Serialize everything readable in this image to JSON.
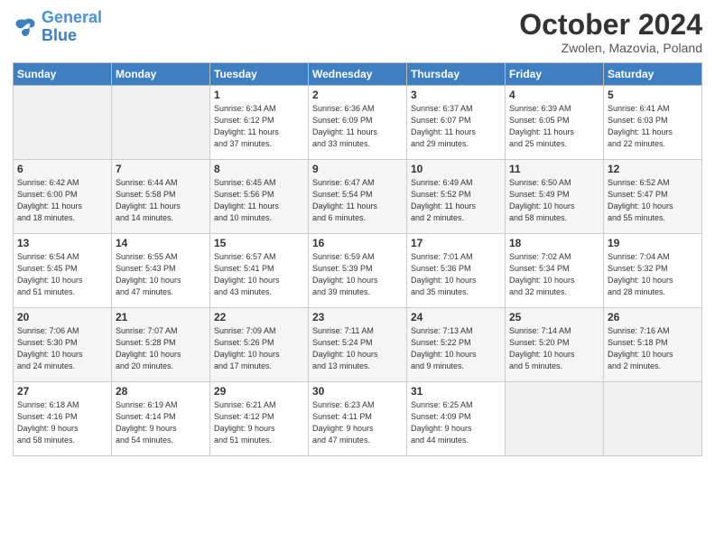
{
  "logo": {
    "line1": "General",
    "line2": "Blue"
  },
  "title": "October 2024",
  "subtitle": "Zwolen, Mazovia, Poland",
  "days_header": [
    "Sunday",
    "Monday",
    "Tuesday",
    "Wednesday",
    "Thursday",
    "Friday",
    "Saturday"
  ],
  "weeks": [
    [
      {
        "day": "",
        "info": ""
      },
      {
        "day": "",
        "info": ""
      },
      {
        "day": "1",
        "info": "Sunrise: 6:34 AM\nSunset: 6:12 PM\nDaylight: 11 hours\nand 37 minutes."
      },
      {
        "day": "2",
        "info": "Sunrise: 6:36 AM\nSunset: 6:09 PM\nDaylight: 11 hours\nand 33 minutes."
      },
      {
        "day": "3",
        "info": "Sunrise: 6:37 AM\nSunset: 6:07 PM\nDaylight: 11 hours\nand 29 minutes."
      },
      {
        "day": "4",
        "info": "Sunrise: 6:39 AM\nSunset: 6:05 PM\nDaylight: 11 hours\nand 25 minutes."
      },
      {
        "day": "5",
        "info": "Sunrise: 6:41 AM\nSunset: 6:03 PM\nDaylight: 11 hours\nand 22 minutes."
      }
    ],
    [
      {
        "day": "6",
        "info": "Sunrise: 6:42 AM\nSunset: 6:00 PM\nDaylight: 11 hours\nand 18 minutes."
      },
      {
        "day": "7",
        "info": "Sunrise: 6:44 AM\nSunset: 5:58 PM\nDaylight: 11 hours\nand 14 minutes."
      },
      {
        "day": "8",
        "info": "Sunrise: 6:45 AM\nSunset: 5:56 PM\nDaylight: 11 hours\nand 10 minutes."
      },
      {
        "day": "9",
        "info": "Sunrise: 6:47 AM\nSunset: 5:54 PM\nDaylight: 11 hours\nand 6 minutes."
      },
      {
        "day": "10",
        "info": "Sunrise: 6:49 AM\nSunset: 5:52 PM\nDaylight: 11 hours\nand 2 minutes."
      },
      {
        "day": "11",
        "info": "Sunrise: 6:50 AM\nSunset: 5:49 PM\nDaylight: 10 hours\nand 58 minutes."
      },
      {
        "day": "12",
        "info": "Sunrise: 6:52 AM\nSunset: 5:47 PM\nDaylight: 10 hours\nand 55 minutes."
      }
    ],
    [
      {
        "day": "13",
        "info": "Sunrise: 6:54 AM\nSunset: 5:45 PM\nDaylight: 10 hours\nand 51 minutes."
      },
      {
        "day": "14",
        "info": "Sunrise: 6:55 AM\nSunset: 5:43 PM\nDaylight: 10 hours\nand 47 minutes."
      },
      {
        "day": "15",
        "info": "Sunrise: 6:57 AM\nSunset: 5:41 PM\nDaylight: 10 hours\nand 43 minutes."
      },
      {
        "day": "16",
        "info": "Sunrise: 6:59 AM\nSunset: 5:39 PM\nDaylight: 10 hours\nand 39 minutes."
      },
      {
        "day": "17",
        "info": "Sunrise: 7:01 AM\nSunset: 5:36 PM\nDaylight: 10 hours\nand 35 minutes."
      },
      {
        "day": "18",
        "info": "Sunrise: 7:02 AM\nSunset: 5:34 PM\nDaylight: 10 hours\nand 32 minutes."
      },
      {
        "day": "19",
        "info": "Sunrise: 7:04 AM\nSunset: 5:32 PM\nDaylight: 10 hours\nand 28 minutes."
      }
    ],
    [
      {
        "day": "20",
        "info": "Sunrise: 7:06 AM\nSunset: 5:30 PM\nDaylight: 10 hours\nand 24 minutes."
      },
      {
        "day": "21",
        "info": "Sunrise: 7:07 AM\nSunset: 5:28 PM\nDaylight: 10 hours\nand 20 minutes."
      },
      {
        "day": "22",
        "info": "Sunrise: 7:09 AM\nSunset: 5:26 PM\nDaylight: 10 hours\nand 17 minutes."
      },
      {
        "day": "23",
        "info": "Sunrise: 7:11 AM\nSunset: 5:24 PM\nDaylight: 10 hours\nand 13 minutes."
      },
      {
        "day": "24",
        "info": "Sunrise: 7:13 AM\nSunset: 5:22 PM\nDaylight: 10 hours\nand 9 minutes."
      },
      {
        "day": "25",
        "info": "Sunrise: 7:14 AM\nSunset: 5:20 PM\nDaylight: 10 hours\nand 5 minutes."
      },
      {
        "day": "26",
        "info": "Sunrise: 7:16 AM\nSunset: 5:18 PM\nDaylight: 10 hours\nand 2 minutes."
      }
    ],
    [
      {
        "day": "27",
        "info": "Sunrise: 6:18 AM\nSunset: 4:16 PM\nDaylight: 9 hours\nand 58 minutes."
      },
      {
        "day": "28",
        "info": "Sunrise: 6:19 AM\nSunset: 4:14 PM\nDaylight: 9 hours\nand 54 minutes."
      },
      {
        "day": "29",
        "info": "Sunrise: 6:21 AM\nSunset: 4:12 PM\nDaylight: 9 hours\nand 51 minutes."
      },
      {
        "day": "30",
        "info": "Sunrise: 6:23 AM\nSunset: 4:11 PM\nDaylight: 9 hours\nand 47 minutes."
      },
      {
        "day": "31",
        "info": "Sunrise: 6:25 AM\nSunset: 4:09 PM\nDaylight: 9 hours\nand 44 minutes."
      },
      {
        "day": "",
        "info": ""
      },
      {
        "day": "",
        "info": ""
      }
    ]
  ]
}
